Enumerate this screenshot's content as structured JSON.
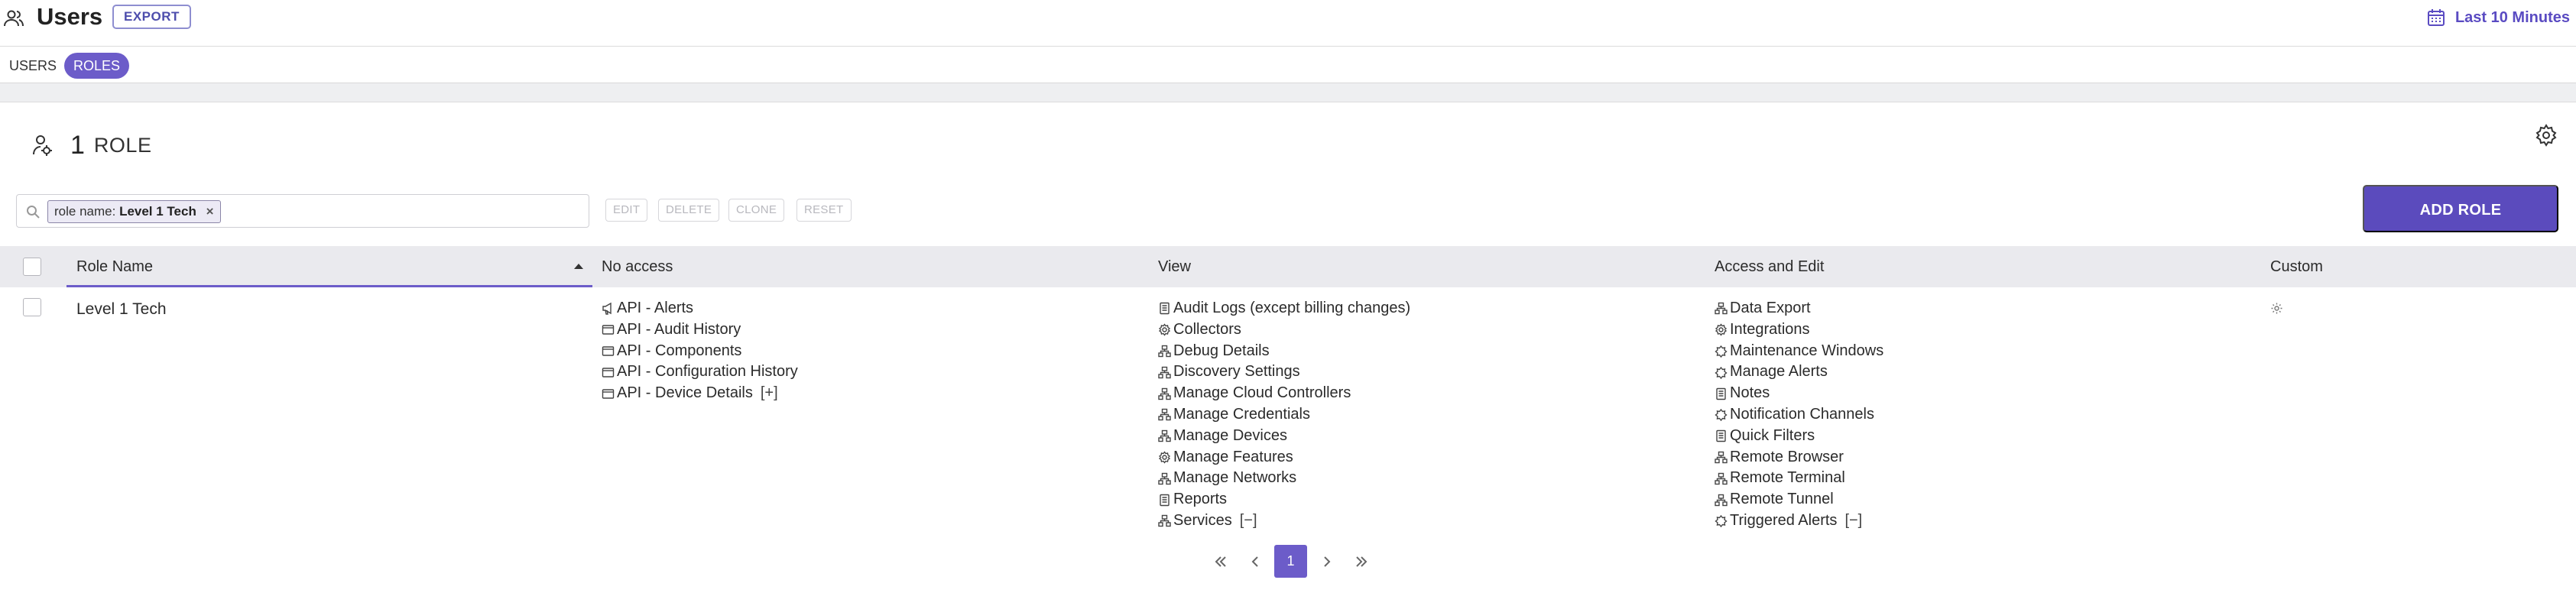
{
  "header": {
    "title": "Users",
    "export_label": "EXPORT",
    "time_range": "Last 10 Minutes",
    "time_icon": "calendar-icon",
    "title_icon": "users-icon"
  },
  "tabs": [
    {
      "label": "USERS",
      "active": false
    },
    {
      "label": "ROLES",
      "active": true
    }
  ],
  "summary": {
    "count": "1",
    "label": "ROLE"
  },
  "filter": {
    "chip_key": "role name:",
    "chip_value": "Level 1 Tech",
    "chip_remove": "×"
  },
  "actions": {
    "edit": "EDIT",
    "delete": "DELETE",
    "clone": "CLONE",
    "reset": "RESET",
    "add_role": "ADD ROLE"
  },
  "table": {
    "columns": [
      "Role Name",
      "No access",
      "View",
      "Access and Edit",
      "Custom"
    ],
    "sort": {
      "column": "Role Name",
      "direction": "ascending"
    },
    "rows": [
      {
        "role_name": "Level 1 Tech",
        "no_access": {
          "items": [
            {
              "label": "API - Alerts",
              "icon": "megaphone-icon"
            },
            {
              "label": "API - Audit History",
              "icon": "window-icon"
            },
            {
              "label": "API - Components",
              "icon": "window-icon"
            },
            {
              "label": "API - Configuration History",
              "icon": "window-icon"
            },
            {
              "label": "API - Device Details",
              "icon": "window-icon"
            }
          ],
          "toggle": "[+]"
        },
        "view": {
          "items": [
            {
              "label": "Audit Logs (except billing changes)",
              "icon": "document-icon"
            },
            {
              "label": "Collectors",
              "icon": "gear-icon"
            },
            {
              "label": "Debug Details",
              "icon": "network-icon"
            },
            {
              "label": "Discovery Settings",
              "icon": "network-icon"
            },
            {
              "label": "Manage Cloud Controllers",
              "icon": "network-icon"
            },
            {
              "label": "Manage Credentials",
              "icon": "network-icon"
            },
            {
              "label": "Manage Devices",
              "icon": "network-icon"
            },
            {
              "label": "Manage Features",
              "icon": "gear-icon"
            },
            {
              "label": "Manage Networks",
              "icon": "network-icon"
            },
            {
              "label": "Reports",
              "icon": "document-icon"
            },
            {
              "label": "Services",
              "icon": "network-icon"
            }
          ],
          "toggle": "[−]"
        },
        "access_edit": {
          "items": [
            {
              "label": "Data Export",
              "icon": "network-icon"
            },
            {
              "label": "Integrations",
              "icon": "gear-icon"
            },
            {
              "label": "Maintenance Windows",
              "icon": "alert-icon"
            },
            {
              "label": "Manage Alerts",
              "icon": "alert-icon"
            },
            {
              "label": "Notes",
              "icon": "document-icon"
            },
            {
              "label": "Notification Channels",
              "icon": "alert-icon"
            },
            {
              "label": "Quick Filters",
              "icon": "document-icon"
            },
            {
              "label": "Remote Browser",
              "icon": "network-icon"
            },
            {
              "label": "Remote Terminal",
              "icon": "network-icon"
            },
            {
              "label": "Remote Tunnel",
              "icon": "network-icon"
            },
            {
              "label": "Triggered Alerts",
              "icon": "alert-icon"
            }
          ],
          "toggle": "[−]"
        },
        "custom": {
          "icon": "custom-gear-icon"
        }
      }
    ]
  },
  "pagination": {
    "current_page": "1",
    "icons": [
      "first-page-icon",
      "prev-page-icon",
      "next-page-icon",
      "last-page-icon"
    ]
  },
  "colors": {
    "accent": "#5b4bbd",
    "accent_light": "#6c5cc9",
    "link": "#5a4bc2"
  }
}
